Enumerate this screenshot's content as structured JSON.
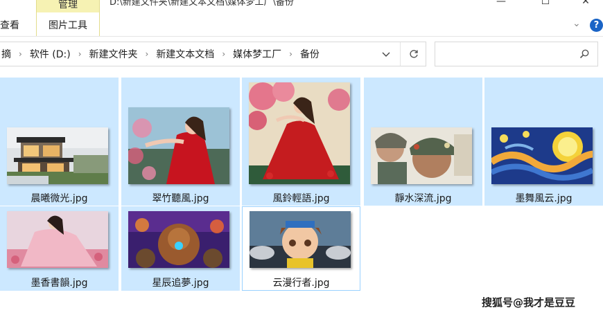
{
  "window": {
    "title_path": "D:\\新建文件夹\\新建文本文档\\媒体梦工厂\\备份",
    "minimize_glyph": "—",
    "maximize_glyph": "☐",
    "close_glyph": "✕"
  },
  "ribbon": {
    "manage_label": "管理",
    "view_label": "查看",
    "picture_tools_label": "图片工具",
    "collapse_glyph": "⌄",
    "help_glyph": "?"
  },
  "address": {
    "crumbs": [
      "摘",
      "软件 (D:)",
      "新建文件夹",
      "新建文本文档",
      "媒体梦工厂",
      "备份"
    ],
    "separator": "›"
  },
  "search": {
    "placeholder": "",
    "value": ""
  },
  "files": [
    {
      "name": "晨曦微光.jpg",
      "thumb": "house",
      "selected": true
    },
    {
      "name": "翠竹聽風.jpg",
      "thumb": "girl-red-pink",
      "selected": true
    },
    {
      "name": "風鈴輕語.jpg",
      "thumb": "girl-red-tree",
      "selected": true
    },
    {
      "name": "靜水深流.jpg",
      "thumb": "soldiers",
      "selected": true
    },
    {
      "name": "墨舞風云.jpg",
      "thumb": "starry",
      "selected": true
    },
    {
      "name": "墨香書韻.jpg",
      "thumb": "girl-pink-field",
      "selected": true
    },
    {
      "name": "星辰追夢.jpg",
      "thumb": "bear-robot",
      "selected": true
    },
    {
      "name": "云漫行者.jpg",
      "thumb": "anime-boy",
      "selected": false
    }
  ],
  "colors": {
    "selection": "#cce8ff",
    "accent": "#1a64c6",
    "manage_tab": "#f6f2b3"
  },
  "watermark": "搜狐号@我才是豆豆"
}
